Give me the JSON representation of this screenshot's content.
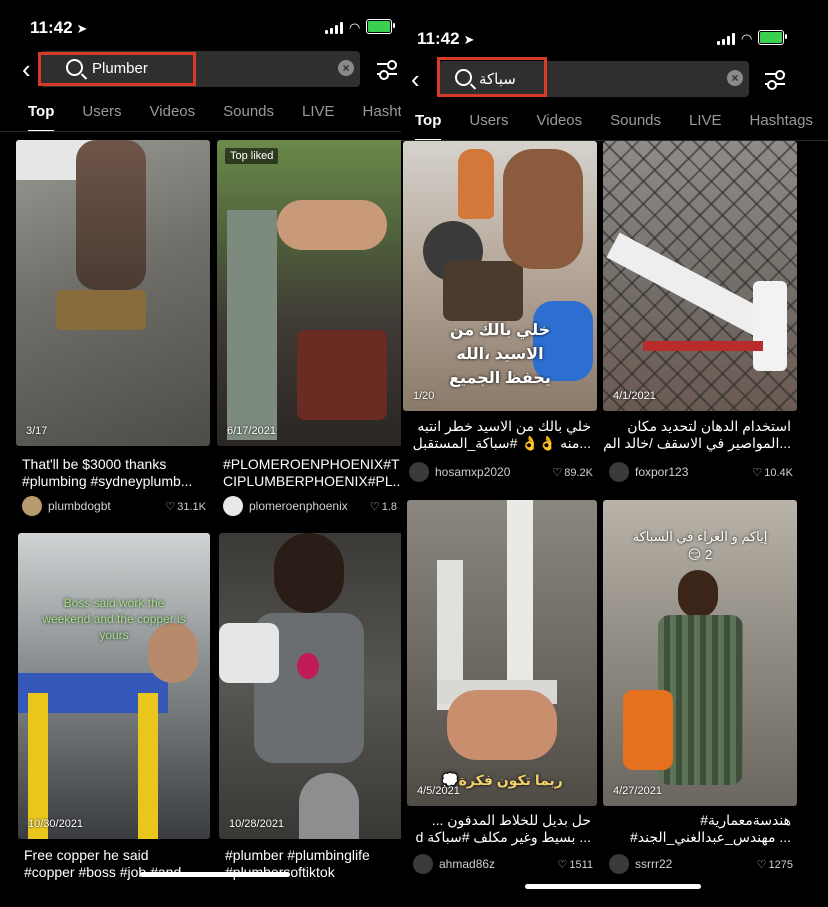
{
  "left": {
    "time": "11:42",
    "query": "Plumber",
    "tabs": [
      "Top",
      "Users",
      "Videos",
      "Sounds",
      "LIVE",
      "Hasht"
    ],
    "cards": [
      {
        "date": "3/17",
        "caption": "That'll be $3000 thanks\n#plumbing #sydneyplumb...",
        "user": "plumbdogbt",
        "likes": "31.1K"
      },
      {
        "badge": "Top liked",
        "date": "6/17/2021",
        "caption": "#PLOMEROENPHOENIX#T\nCIPLUMBERPHOENIX#PL...",
        "user": "plomeroenphoenix",
        "likes": "1.8"
      },
      {
        "date": "10/30/2021",
        "overlay": "Boss said work the weekend and the copper is yours",
        "caption": "Free copper he said\n#copper #boss #job #and..."
      },
      {
        "date": "10/28/2021",
        "caption": "#plumber #plumbinglife\n#plumbersoftiktok"
      }
    ]
  },
  "right": {
    "time": "11:42",
    "query": "سباكة",
    "tabs": [
      "Top",
      "Users",
      "Videos",
      "Sounds",
      "LIVE",
      "Hashtags"
    ],
    "cards": [
      {
        "date": "1/20",
        "overlay": "خلي بالك من الاسيد ،الله يحفظ الجميع",
        "caption": "خلي بالك من الاسيد خطر انتبه\n...منه 👌👌 #سباكة_المستقبل",
        "user": "hosamxp2020",
        "likes": "89.2K"
      },
      {
        "date": "4/1/2021",
        "caption": "استخدام الدهان لتحديد مكان\n...المواصير في الاسقف /خالد الم",
        "user": "foxpor123",
        "likes": "10.4K"
      },
      {
        "date": "4/5/2021",
        "overlay": "ربما تكون فكرة💭",
        "caption": "حل بديل للخلاط المدفون ...\n... بسيط وغير مكلف #سباكة d",
        "user": "ahmad86z",
        "likes": "1511"
      },
      {
        "date": "4/27/2021",
        "overlay": "إياكم و الغراء في السباكة\n2 😏",
        "caption": "هندسةمعمارية#\n... مهندس_عبدالغني_الجند#",
        "user": "ssrrr22",
        "likes": "1275"
      }
    ]
  },
  "colors": {
    "highlight": "#d83a2a",
    "search_bg": "#2f2f2f",
    "battery": "#3ad04f"
  }
}
